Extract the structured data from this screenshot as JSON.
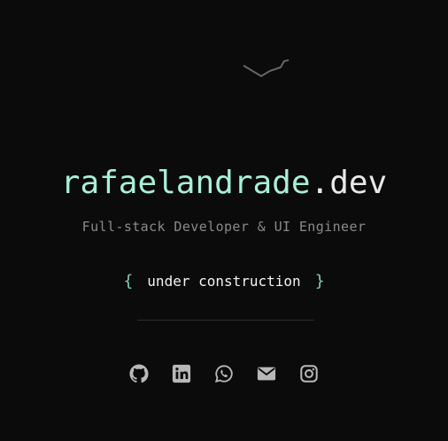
{
  "header": {
    "logo_icon": "zigzag-logo-icon",
    "title_name": "rafaelandrade",
    "title_tld": ".dev",
    "subtitle": "Full-stack Developer & UI Engineer"
  },
  "status": {
    "brace_open": "{",
    "text": "under construction",
    "brace_close": "}"
  },
  "socials": {
    "items": [
      {
        "icon": "github-icon"
      },
      {
        "icon": "linkedin-icon"
      },
      {
        "icon": "whatsapp-icon"
      },
      {
        "icon": "email-icon"
      },
      {
        "icon": "instagram-icon"
      }
    ]
  },
  "colors": {
    "background": "#0b0b0b",
    "accent": "#a8f0d8",
    "brace": "#7fd1b4",
    "text": "#e8e8e8",
    "muted": "#8a8a8a",
    "icon": "#b8b8b8",
    "divider": "#2f2f2f"
  }
}
